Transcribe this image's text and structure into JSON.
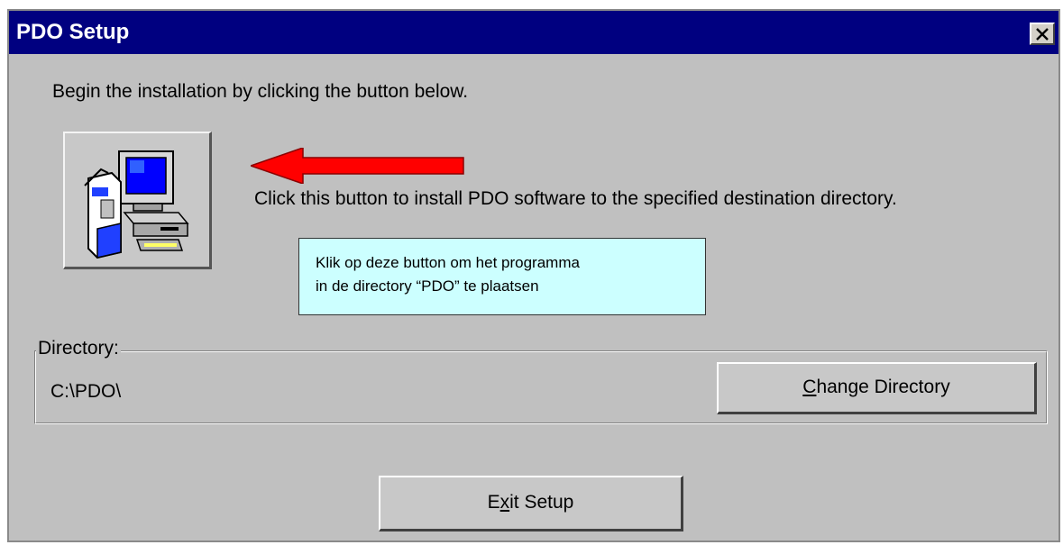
{
  "window": {
    "title": "PDO Setup"
  },
  "intro_text": "Begin the installation by clicking the button below.",
  "install": {
    "description": "Click this button to install PDO software to the specified destination directory."
  },
  "annotation": {
    "line1": "Klik op deze button om het programma",
    "line2": "in de directory “PDO” te plaatsen",
    "arrow_color": "#ff0000"
  },
  "directory": {
    "label": "Directory:",
    "path": "C:\\PDO\\",
    "change_button": {
      "mnemonic": "C",
      "rest": "hange Directory"
    }
  },
  "exit_button": {
    "before": "E",
    "mnemonic": "x",
    "after": "it Setup"
  },
  "colors": {
    "titlebar": "#000080",
    "dialog": "#c0c0c0",
    "tooltip": "#ccffff"
  }
}
